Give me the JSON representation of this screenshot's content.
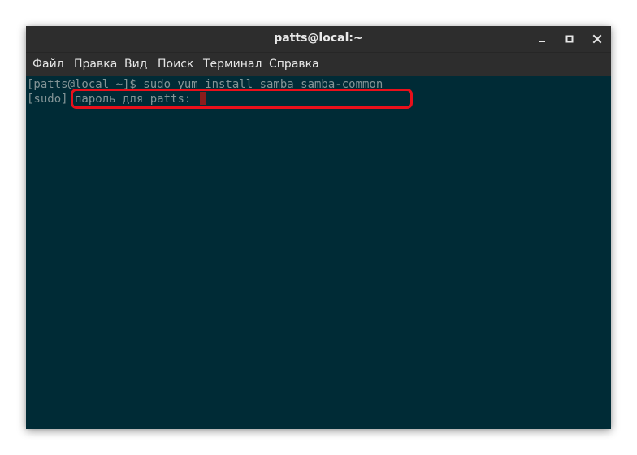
{
  "window": {
    "title": "patts@local:~",
    "controls": {
      "minimize_icon": "minimize-icon",
      "maximize_icon": "maximize-icon",
      "close_icon": "close-icon"
    }
  },
  "menubar": {
    "items": [
      {
        "label": "Файл"
      },
      {
        "label": "Правка"
      },
      {
        "label": "Вид"
      },
      {
        "label": "Поиск"
      },
      {
        "label": "Терминал"
      },
      {
        "label": "Справка"
      }
    ]
  },
  "terminal": {
    "lines": [
      {
        "prompt": "[patts@local ~]$",
        "text": " sudo yum install samba samba-common"
      },
      {
        "prompt": "[sudo]",
        "text": " пароль для patts: "
      }
    ],
    "highlight_color": "#e8101b",
    "background_color": "#002b36",
    "text_color": "#839496"
  }
}
